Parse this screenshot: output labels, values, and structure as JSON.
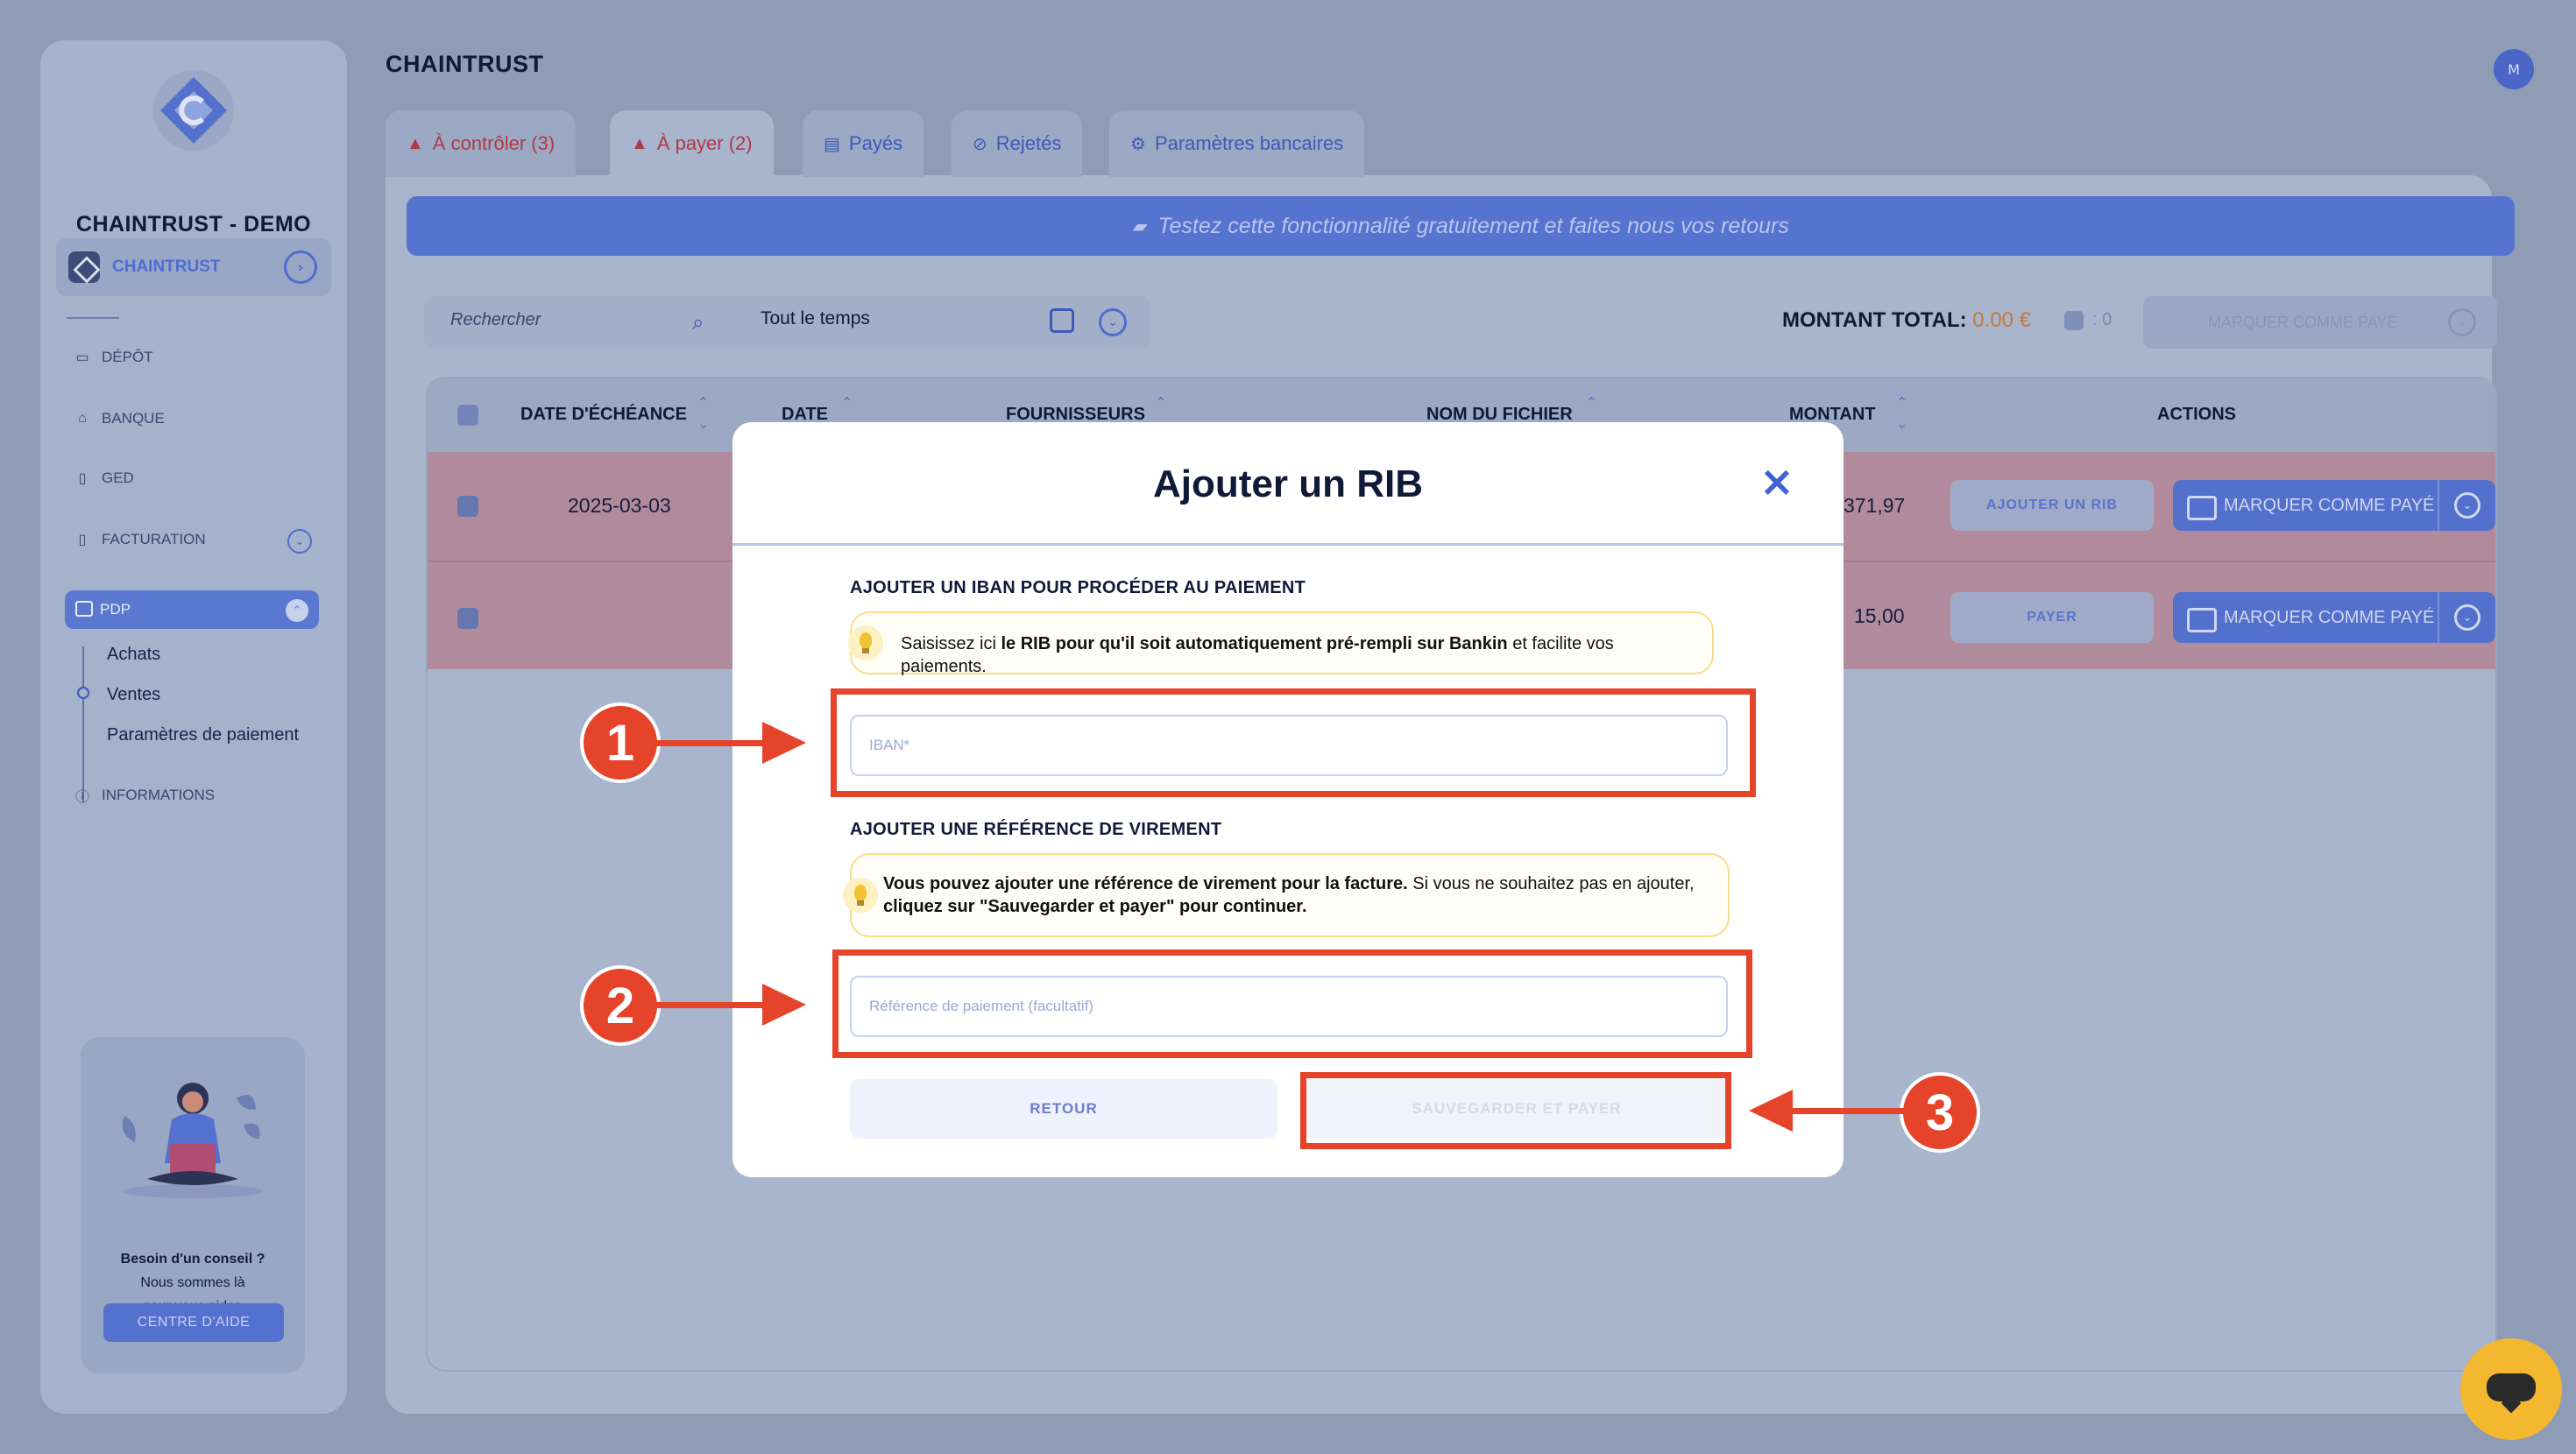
{
  "sidebar": {
    "brand": "CHAINTRUST - DEMO",
    "org": "CHAINTRUST",
    "nav": [
      {
        "label": "DÉPÔT",
        "icon": "folder-icon"
      },
      {
        "label": "BANQUE",
        "icon": "bank-icon"
      },
      {
        "label": "GED",
        "icon": "document-icon"
      },
      {
        "label": "FACTURATION",
        "icon": "invoice-icon"
      }
    ],
    "pdp": "PDP",
    "sub_items": [
      "Achats",
      "Ventes",
      "Paramètres de paiement"
    ],
    "informations": "INFORMATIONS",
    "help": {
      "line1": "Besoin d'un conseil ?",
      "line2": "Nous sommes là",
      "line3": "pour vous aider.",
      "button": "CENTRE D'AIDE"
    }
  },
  "header": {
    "title": "CHAINTRUST",
    "avatar": "M"
  },
  "tabs": [
    {
      "label": "À contrôler (3)",
      "icon": "warning-icon"
    },
    {
      "label": "À payer (2)",
      "icon": "warning-icon"
    },
    {
      "label": "Payés",
      "icon": "card-icon"
    },
    {
      "label": "Rejetés",
      "icon": "ban-icon"
    },
    {
      "label": "Paramètres bancaires",
      "icon": "gear-icon"
    }
  ],
  "banner": "Testez cette fonctionnalité gratuitement et faites nous vos retours",
  "toolbar": {
    "search_placeholder": "Rechercher",
    "time_filter": "Tout le temps",
    "total_label": "MONTANT TOTAL:",
    "total_value": "0.00 €",
    "selected": ": 0",
    "bulk_action": "MARQUER COMME PAYÉ"
  },
  "table": {
    "headers": [
      "DATE D'ÉCHÉANCE",
      "DATE",
      "FOURNISSEURS",
      "NOM DU FICHIER",
      "MONTANT",
      "ACTIONS"
    ],
    "rows": [
      {
        "due_date": "2025-03-03",
        "amount": "371,97",
        "action": "AJOUTER UN RIB",
        "primary": "MARQUER COMME PAYÉ"
      },
      {
        "due_date": "",
        "amount": "15,00",
        "action": "PAYER",
        "primary": "MARQUER COMME PAYÉ"
      }
    ]
  },
  "modal": {
    "title": "Ajouter un RIB",
    "section1": "AJOUTER UN IBAN POUR PROCÉDER AU PAIEMENT",
    "tip1_a": "Saisissez ici ",
    "tip1_b": "le RIB pour qu'il soit automatiquement pré-rempli sur Bankin",
    "tip1_c": " et facilite vos paiements.",
    "iban_placeholder": "IBAN*",
    "section2": "AJOUTER UNE RÉFÉRENCE DE VIREMENT",
    "tip2_a": "Vous pouvez ajouter une référence de virement pour la facture.",
    "tip2_b": " Si vous ne souhaitez pas en ajouter,",
    "tip2_c": "cliquez sur \"Sauvegarder et payer\" pour continuer.",
    "ref_placeholder": "Référence de paiement (facultatif)",
    "back": "RETOUR",
    "save": "SAUVEGARDER ET PAYER"
  },
  "annotations": [
    "1",
    "2",
    "3"
  ],
  "colors": {
    "accent": "#5470cd",
    "annotation": "#e5432a",
    "warning_tab": "#b03a47",
    "total_amount": "#c27a3a"
  }
}
